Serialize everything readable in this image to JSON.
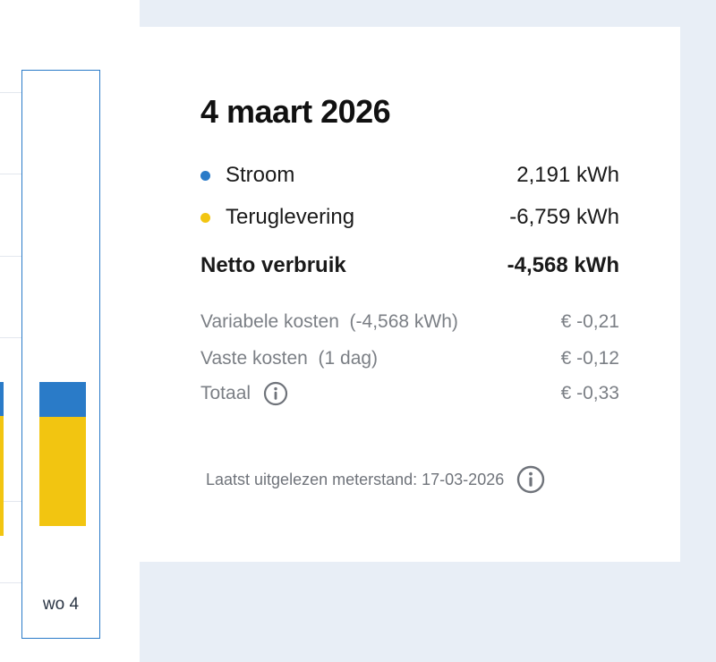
{
  "chart": {
    "selected_day_label": "wo 4",
    "colors": {
      "stroom": "#2a7bc8",
      "teruglevering": "#f2c511"
    }
  },
  "detail": {
    "date_title": "4 maart 2026",
    "stroom": {
      "label": "Stroom",
      "value": "2,191 kWh",
      "color": "#2a7bc8"
    },
    "teruglevering": {
      "label": "Teruglevering",
      "value": "-6,759 kWh",
      "color": "#f2c511"
    },
    "netto": {
      "label": "Netto verbruik",
      "value": "-4,568 kWh"
    },
    "variabele": {
      "label": "Variabele kosten  (-4,568 kWh)",
      "value": "€ -0,21"
    },
    "vaste": {
      "label": "Vaste kosten  (1 dag)",
      "value": "€ -0,12"
    },
    "totaal": {
      "label": "Totaal",
      "value": "€ -0,33",
      "icon": "info-icon"
    },
    "footer": {
      "text": "Laatst uitgelezen meterstand: 17-03-2026",
      "icon": "info-icon"
    }
  }
}
